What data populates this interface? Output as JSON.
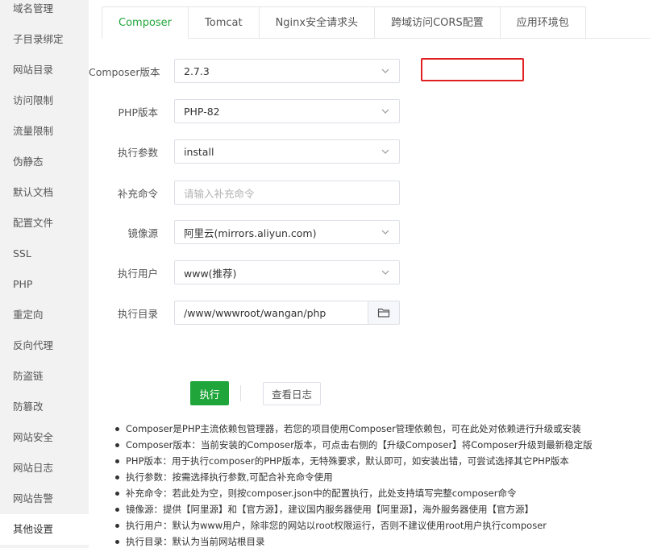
{
  "sidebar": {
    "items": [
      {
        "label": "域名管理"
      },
      {
        "label": "子目录绑定"
      },
      {
        "label": "网站目录"
      },
      {
        "label": "访问限制"
      },
      {
        "label": "流量限制"
      },
      {
        "label": "伪静态"
      },
      {
        "label": "默认文档"
      },
      {
        "label": "配置文件"
      },
      {
        "label": "SSL"
      },
      {
        "label": "PHP"
      },
      {
        "label": "重定向"
      },
      {
        "label": "反向代理"
      },
      {
        "label": "防盗链"
      },
      {
        "label": "防篡改"
      },
      {
        "label": "网站安全"
      },
      {
        "label": "网站日志"
      },
      {
        "label": "网站告警"
      },
      {
        "label": "其他设置"
      }
    ],
    "active": "其他设置"
  },
  "tabs": [
    {
      "label": "Composer",
      "active": true
    },
    {
      "label": "Tomcat"
    },
    {
      "label": "Nginx安全请求头"
    },
    {
      "label": "跨域访问CORS配置"
    },
    {
      "label": "应用环境包"
    }
  ],
  "form": {
    "composer_version": {
      "label": "Composer版本",
      "value": "2.7.3"
    },
    "php_version": {
      "label": "PHP版本",
      "value": "PHP-82"
    },
    "exec_params": {
      "label": "执行参数",
      "value": "install"
    },
    "extra_cmd": {
      "label": "补充命令",
      "placeholder": "请输入补充命令"
    },
    "mirror": {
      "label": "镜像源",
      "value": "阿里云(mirrors.aliyun.com)"
    },
    "exec_user": {
      "label": "执行用户",
      "value": "www(推荐)"
    },
    "exec_dir": {
      "label": "执行目录",
      "value": "/www/wwwroot/wangan/php"
    }
  },
  "buttons": {
    "run": "执行",
    "view_log": "查看日志"
  },
  "help": [
    "Composer是PHP主流依赖包管理器，若您的项目使用Composer管理依赖包，可在此处对依赖进行升级或安装",
    "Composer版本：当前安装的Composer版本，可点击右侧的【升级Composer】将Composer升级到最新稳定版",
    "PHP版本：用于执行composer的PHP版本，无特殊要求，默认即可，如安装出错，可尝试选择其它PHP版本",
    "执行参数：按需选择执行参数,可配合补充命令使用",
    "补充命令：若此处为空，则按composer.json中的配置执行，此处支持填写完整composer命令",
    "镜像源：提供【阿里源】和【官方源】，建议国内服务器使用【阿里源】，海外服务器使用【官方源】",
    "执行用户：默认为www用户，除非您的网站以root权限运行，否则不建议使用root用户执行composer",
    "执行目录：默认为当前网站根目录"
  ],
  "colors": {
    "accent": "#20a53a",
    "highlight": "#e02020"
  },
  "icons": {
    "select_arrow": "chevron-down-icon",
    "dir_picker": "folder-icon"
  }
}
